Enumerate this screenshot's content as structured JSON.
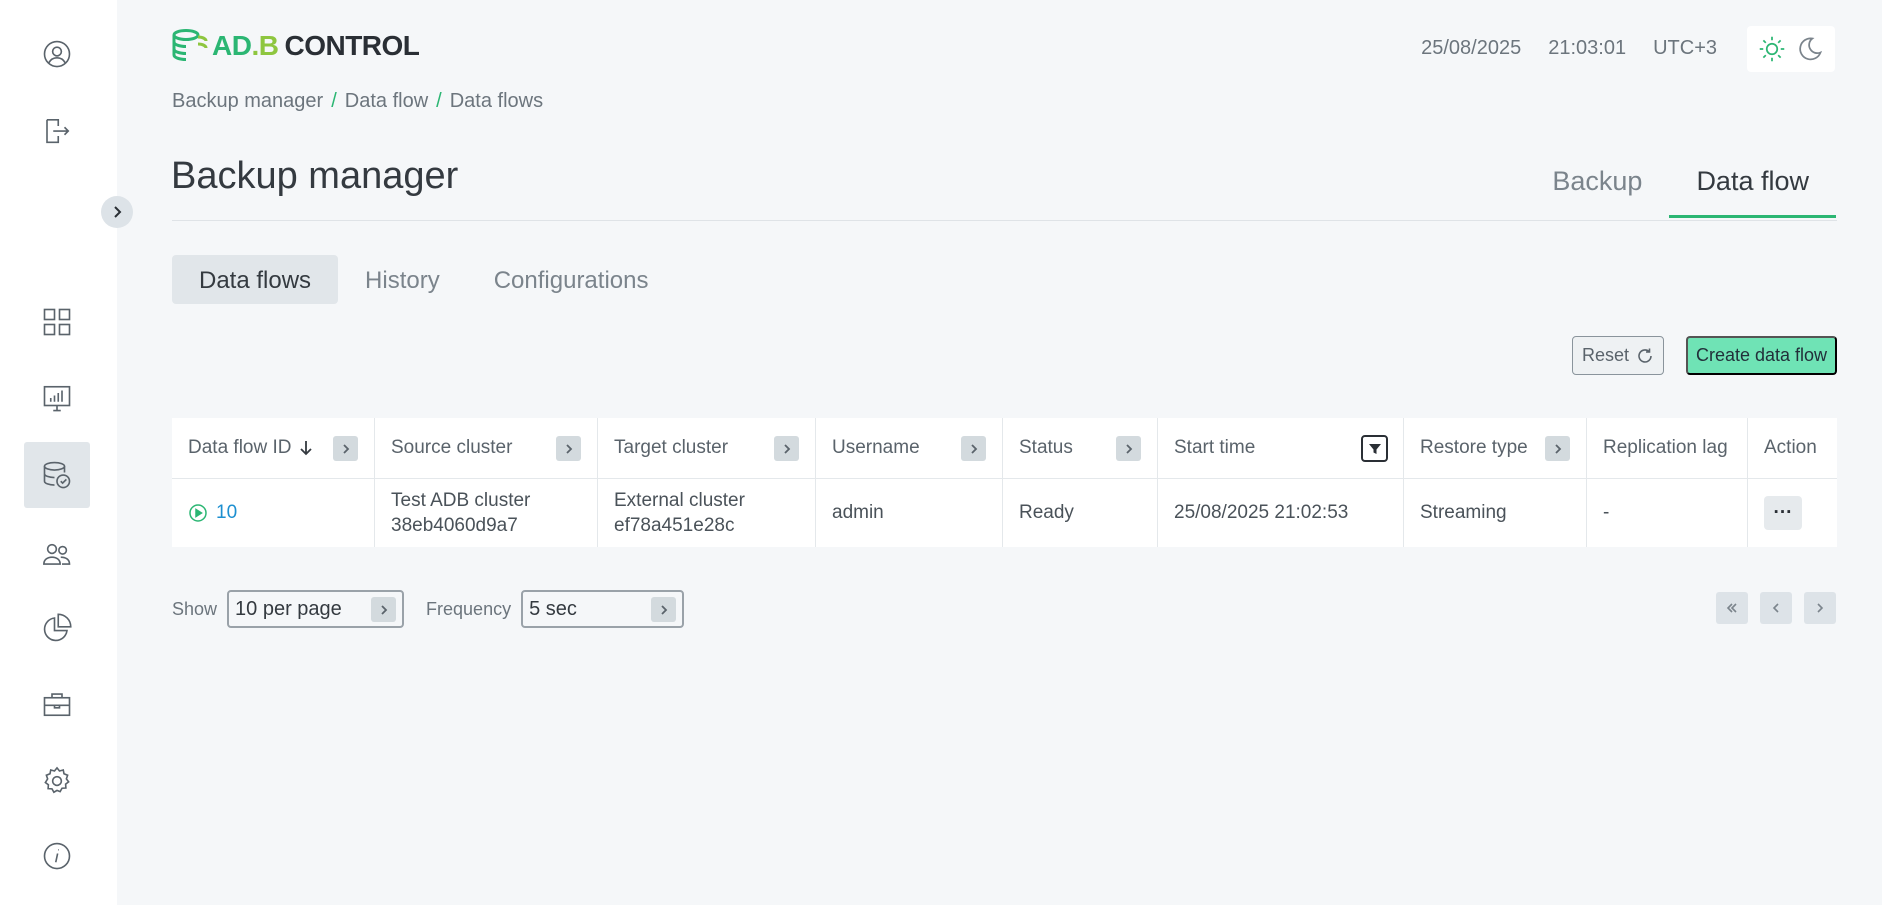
{
  "colors": {
    "accent": "#2bb673",
    "accent_light": "#6fe3b5",
    "link": "#1c8fd0",
    "sidebar_active_bg": "#e1e6ea"
  },
  "sidebar": {
    "items": [
      {
        "icon": "user-icon"
      },
      {
        "icon": "logout-icon"
      },
      {
        "icon": "dashboard-grid-icon"
      },
      {
        "icon": "monitoring-chart-icon"
      },
      {
        "icon": "backup-database-icon",
        "active": true
      },
      {
        "icon": "users-group-icon"
      },
      {
        "icon": "pie-chart-icon"
      },
      {
        "icon": "briefcase-icon"
      },
      {
        "icon": "gear-icon"
      },
      {
        "icon": "info-icon"
      }
    ]
  },
  "header": {
    "logo": {
      "ad": "AD",
      "dot": ".",
      "b": "B",
      "control": "CONTROL"
    },
    "date": "25/08/2025",
    "time": "21:03:01",
    "timezone": "UTC+3"
  },
  "breadcrumb": [
    "Backup manager",
    "Data flow",
    "Data flows"
  ],
  "page_title": "Backup manager",
  "main_tabs": [
    {
      "label": "Backup",
      "active": false
    },
    {
      "label": "Data flow",
      "active": true
    }
  ],
  "sub_tabs": [
    {
      "label": "Data flows",
      "active": true
    },
    {
      "label": "History",
      "active": false
    },
    {
      "label": "Configurations",
      "active": false
    }
  ],
  "toolbar": {
    "reset_label": "Reset",
    "create_label": "Create data flow"
  },
  "table": {
    "columns": [
      "Data flow ID",
      "Source cluster",
      "Target cluster",
      "Username",
      "Status",
      "Start time",
      "Restore type",
      "Replication lag",
      "Action"
    ],
    "rows": [
      {
        "id": "10",
        "source_name": "Test ADB cluster",
        "source_id": "38eb4060d9a7",
        "target_name": "External cluster",
        "target_id": "ef78a451e28c",
        "username": "admin",
        "status": "Ready",
        "start_time": "25/08/2025 21:02:53",
        "restore_type": "Streaming",
        "replication_lag": "-",
        "action": "···"
      }
    ]
  },
  "pagination": {
    "show_label": "Show",
    "per_page": "10 per page",
    "frequency_label": "Frequency",
    "frequency": "5 sec"
  }
}
